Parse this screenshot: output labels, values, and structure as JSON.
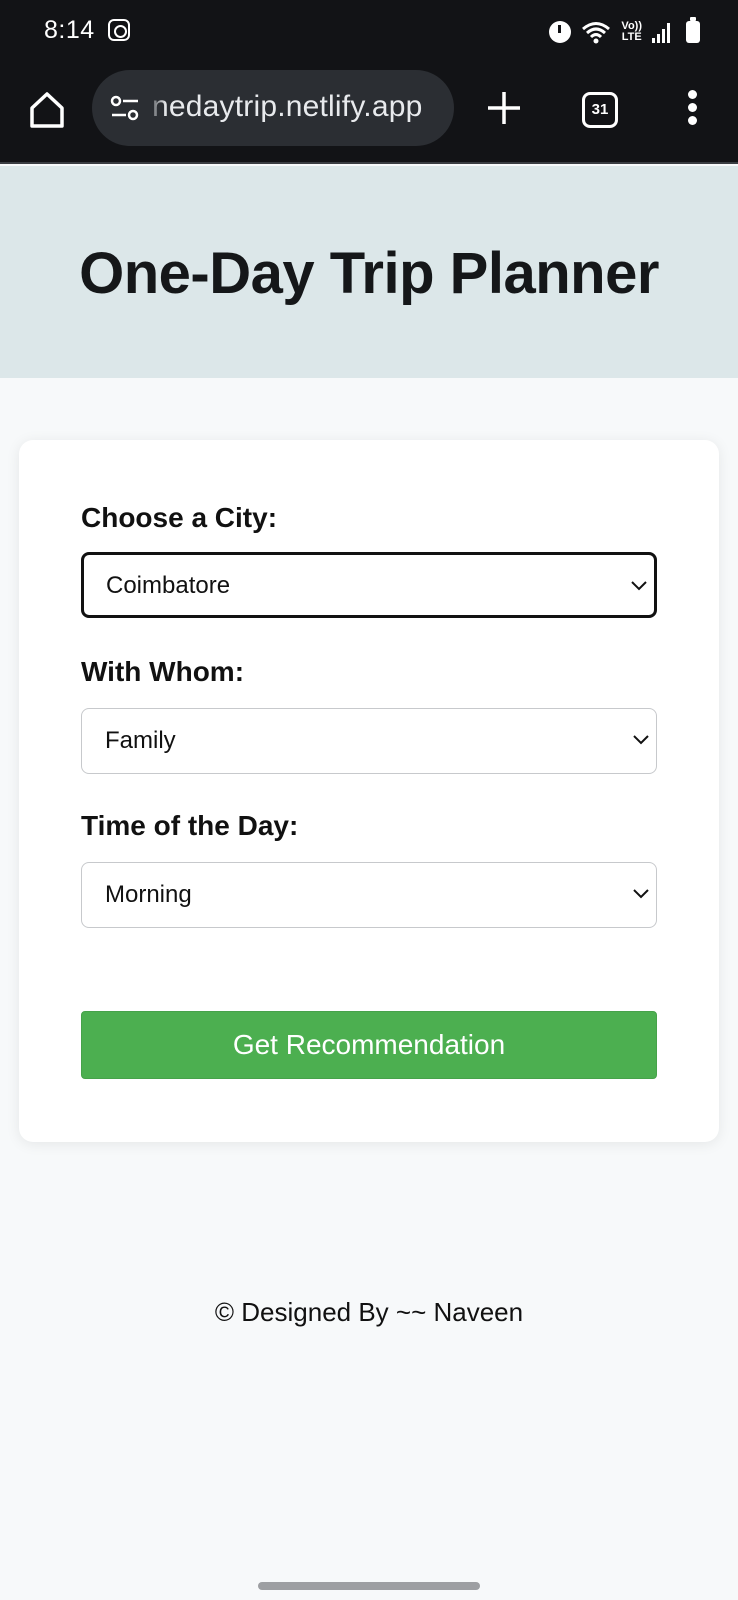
{
  "status_bar": {
    "time": "8:14",
    "network_label_top": "Vo))",
    "network_label_bottom": "LTE"
  },
  "browser": {
    "url": "nedaytrip.netlify.app",
    "tab_count": "31"
  },
  "page": {
    "title": "One-Day Trip Planner",
    "fields": [
      {
        "label": "Choose a City:",
        "value": "Coimbatore"
      },
      {
        "label": "With Whom:",
        "value": "Family"
      },
      {
        "label": "Time of the Day:",
        "value": "Morning"
      }
    ],
    "submit_label": "Get Recommendation",
    "footer": "© Designed By ~~ Naveen"
  },
  "colors": {
    "header_bg": "#dce7e9",
    "button_bg": "#4caf50",
    "browser_bg": "#121316"
  }
}
